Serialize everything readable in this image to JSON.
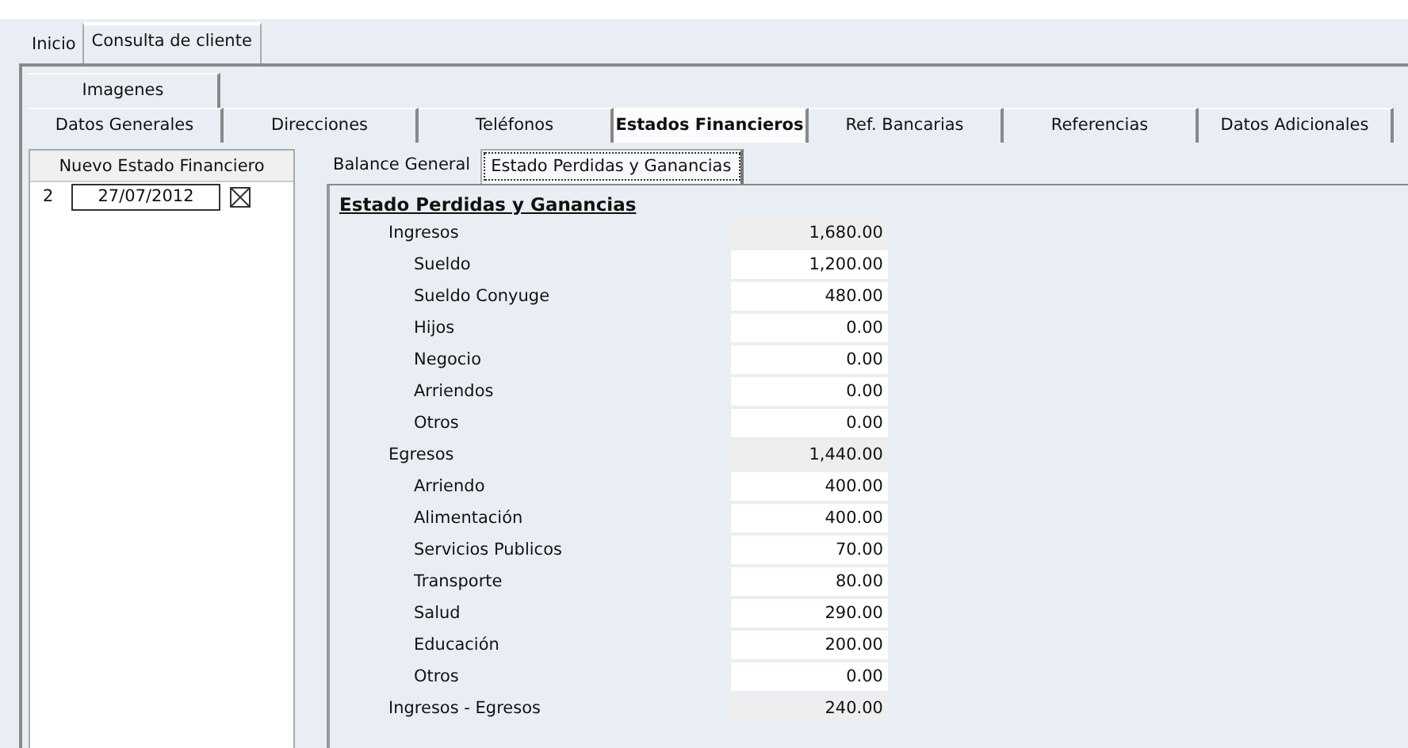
{
  "app_tabs": [
    {
      "label": "Inicio",
      "selected": false
    },
    {
      "label": "Consulta de cliente",
      "selected": true
    }
  ],
  "section_tabs_row_1": [
    {
      "label": "Imagenes",
      "selected": false
    }
  ],
  "section_tabs_row_2": [
    {
      "label": "Datos Generales",
      "selected": false
    },
    {
      "label": "Direcciones",
      "selected": false
    },
    {
      "label": "Teléfonos",
      "selected": false
    },
    {
      "label": "Estados Financieros",
      "selected": true
    },
    {
      "label": "Ref. Bancarias",
      "selected": false
    },
    {
      "label": "Referencias",
      "selected": false
    },
    {
      "label": "Datos Adicionales",
      "selected": false
    }
  ],
  "sidebar": {
    "new_button": "Nuevo Estado Financiero",
    "statements": [
      {
        "number": "2",
        "date": "27/07/2012"
      }
    ]
  },
  "sub_tabs": [
    {
      "label": "Balance General",
      "selected": false
    },
    {
      "label": "Estado Perdidas y Ganancias",
      "selected": true
    }
  ],
  "statement": {
    "title": "Estado Perdidas y Ganancias",
    "rows": [
      {
        "label": "Ingresos",
        "value": "1,680.00",
        "children": [
          {
            "label": "Sueldo",
            "value": "1,200.00"
          },
          {
            "label": "Sueldo Conyuge",
            "value": "480.00"
          },
          {
            "label": "Hijos",
            "value": "0.00"
          },
          {
            "label": "Negocio",
            "value": "0.00"
          },
          {
            "label": "Arriendos",
            "value": "0.00"
          },
          {
            "label": "Otros",
            "value": "0.00"
          }
        ]
      },
      {
        "label": "Egresos",
        "value": "1,440.00",
        "children": [
          {
            "label": "Arriendo",
            "value": "400.00"
          },
          {
            "label": "Alimentación",
            "value": "400.00"
          },
          {
            "label": "Servicios Publicos",
            "value": "70.00"
          },
          {
            "label": "Transporte",
            "value": "80.00"
          },
          {
            "label": "Salud",
            "value": "290.00"
          },
          {
            "label": "Educación",
            "value": "200.00"
          },
          {
            "label": "Otros",
            "value": "0.00"
          }
        ]
      },
      {
        "label": "Ingresos - Egresos",
        "value": "240.00"
      }
    ]
  }
}
